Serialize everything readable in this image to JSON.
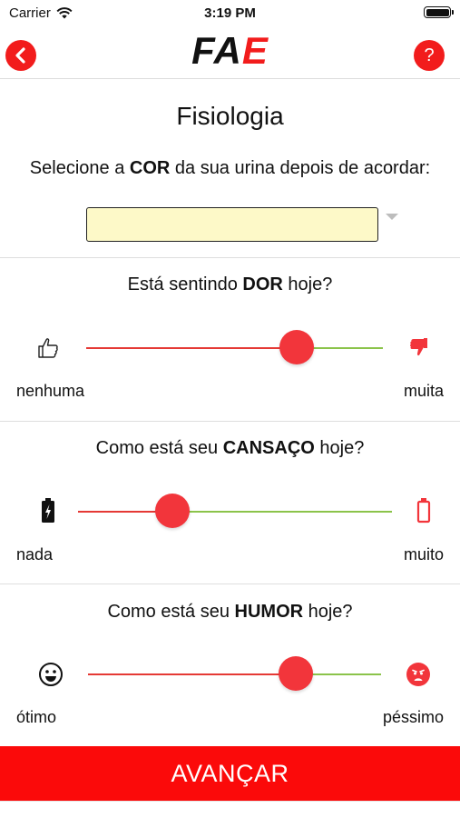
{
  "status_bar": {
    "carrier": "Carrier",
    "time": "3:19 PM"
  },
  "header": {
    "back_icon": "chevron-left-icon",
    "help_label": "?",
    "logo_fa": "FA",
    "logo_e": "E",
    "logo_accent_color": "#f21c1c"
  },
  "page": {
    "title": "Fisiologia",
    "urine": {
      "prompt_pre": "Selecione a ",
      "prompt_bold": "COR",
      "prompt_post": " da sua urina depois de acordar:",
      "selected_color": "#fdf9c8"
    },
    "pain": {
      "prompt_pre": "Está sentindo ",
      "prompt_bold": "DOR",
      "prompt_post": " hoje?",
      "min_label": "nenhuma",
      "max_label": "muita",
      "min_icon": "thumbs-up-icon",
      "max_icon": "thumbs-down-icon",
      "value": 0.71
    },
    "tiredness": {
      "prompt_pre": "Como está seu ",
      "prompt_bold": "CANSAÇO",
      "prompt_post": " hoje?",
      "min_label": "nada",
      "max_label": "muito",
      "min_icon": "battery-charging-icon",
      "max_icon": "battery-empty-icon",
      "value": 0.3
    },
    "mood": {
      "prompt_pre": "Como está seu ",
      "prompt_bold": "HUMOR",
      "prompt_post": " hoje?",
      "min_label": "ótimo",
      "max_label": "péssimo",
      "min_icon": "happy-face-icon",
      "max_icon": "sad-face-icon",
      "value": 0.71
    }
  },
  "cta": {
    "label": "AVANÇAR",
    "color": "#fb0a0a"
  },
  "colors": {
    "accent_red": "#f2353b",
    "track_left": "#e53935",
    "track_right": "#8bc34a"
  }
}
